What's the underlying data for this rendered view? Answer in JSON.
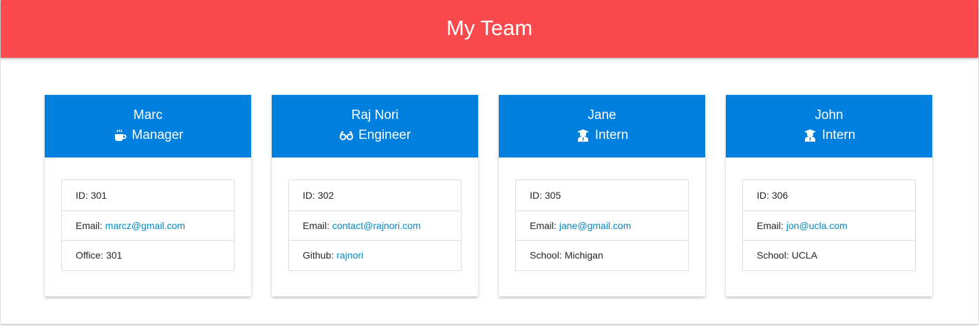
{
  "header": {
    "title": "My Team",
    "color": "#fa4a4e"
  },
  "accent": {
    "card_header": "#0080de",
    "link": "#0089c9"
  },
  "members": [
    {
      "name": "Marc",
      "role": "Manager",
      "role_icon": "mug-icon",
      "id_label": "ID:",
      "id": "301",
      "email_label": "Email:",
      "email": "marcz@gmail.com",
      "extra_label": "Office:",
      "extra": "301"
    },
    {
      "name": "Raj Nori",
      "role": "Engineer",
      "role_icon": "glasses-icon",
      "id_label": "ID:",
      "id": "302",
      "email_label": "Email:",
      "email": "contact@rajnori.com",
      "extra_label": "Github:",
      "extra": "rajnori"
    },
    {
      "name": "Jane",
      "role": "Intern",
      "role_icon": "graduate-icon",
      "id_label": "ID:",
      "id": "305",
      "email_label": "Email:",
      "email": "jane@gmail.com",
      "extra_label": "School:",
      "extra": "Michigan"
    },
    {
      "name": "John",
      "role": "Intern",
      "role_icon": "graduate-icon",
      "id_label": "ID:",
      "id": "306",
      "email_label": "Email:",
      "email": "jon@ucla.com",
      "extra_label": "School:",
      "extra": "UCLA"
    }
  ]
}
